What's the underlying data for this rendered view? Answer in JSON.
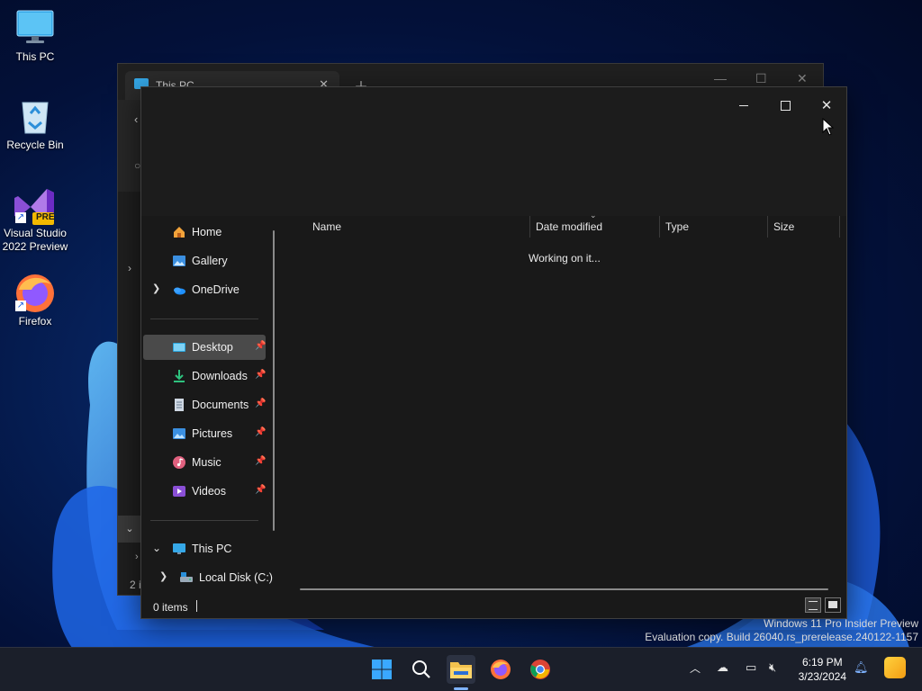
{
  "desktop": {
    "icons": [
      {
        "label": "This PC"
      },
      {
        "label": "Recycle Bin"
      },
      {
        "label": "Visual Studio\n2022 Preview"
      },
      {
        "label": "Firefox"
      }
    ],
    "vs_badge": "PRE"
  },
  "back_window": {
    "tab_title": "This PC",
    "status_partial": "2 i"
  },
  "explorer": {
    "nav": {
      "home": "Home",
      "gallery": "Gallery",
      "onedrive": "OneDrive",
      "desktop": "Desktop",
      "downloads": "Downloads",
      "documents": "Documents",
      "pictures": "Pictures",
      "music": "Music",
      "videos": "Videos",
      "this_pc": "This PC",
      "local_disk": "Local Disk (C:)"
    },
    "columns": {
      "name": "Name",
      "date_modified": "Date modified",
      "type": "Type",
      "size": "Size"
    },
    "loading_text": "Working on it...",
    "status": {
      "items": "0 items"
    }
  },
  "watermark": {
    "line1": "Windows 11 Pro Insider Preview",
    "line2": "Evaluation copy. Build 26040.rs_prerelease.240122-1157"
  },
  "taskbar": {
    "time": "6:19 PM",
    "date": "3/23/2024",
    "pinned": [
      "start-button",
      "search-button",
      "file-explorer",
      "firefox",
      "chrome"
    ]
  },
  "colors": {
    "accent": "#7fb3ff",
    "window_bg": "#191919",
    "selected_nav": "#4a4a4a"
  }
}
